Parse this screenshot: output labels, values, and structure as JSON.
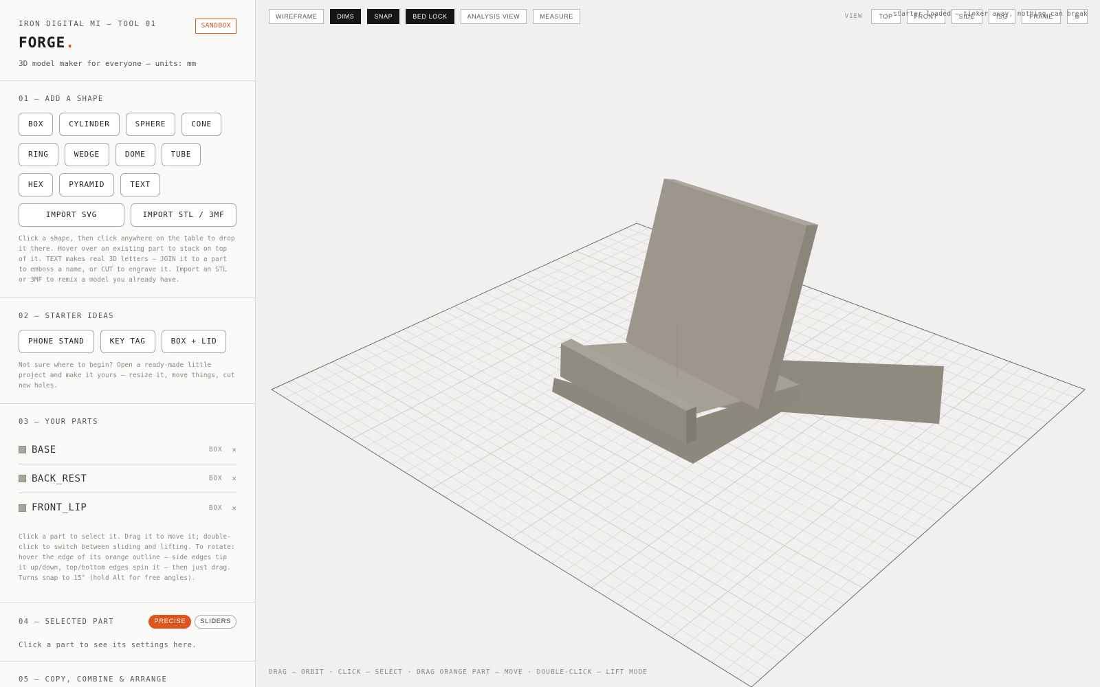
{
  "header": {
    "brand_line": "IRON DIGITAL MI — TOOL 01",
    "badge": "SANDBOX",
    "title": "FORGE",
    "title_dot": ".",
    "tagline": "3D model maker for everyone — units: mm"
  },
  "add_shape": {
    "title": "01 — ADD A SHAPE",
    "shapes": [
      "BOX",
      "CYLINDER",
      "SPHERE",
      "CONE",
      "RING",
      "WEDGE",
      "DOME",
      "TUBE",
      "HEX",
      "PYRAMID",
      "TEXT"
    ],
    "import_svg": "IMPORT SVG",
    "import_stl": "IMPORT STL / 3MF",
    "help": "Click a shape, then click anywhere on the table to drop it there. Hover over an existing part to stack on top of it. TEXT makes real 3D letters — JOIN it to a part to emboss a name, or CUT to engrave it. Import an STL or 3MF to remix a model you already have."
  },
  "starter": {
    "title": "02 — STARTER IDEAS",
    "ideas": [
      "PHONE STAND",
      "KEY TAG",
      "BOX + LID"
    ],
    "help": "Not sure where to begin? Open a ready-made little project and make it yours — resize it, move things, cut new holes."
  },
  "parts": {
    "title": "03 — YOUR PARTS",
    "items": [
      {
        "name": "BASE",
        "kind": "BOX",
        "remove": "×"
      },
      {
        "name": "BACK_REST",
        "kind": "BOX",
        "remove": "×"
      },
      {
        "name": "FRONT_LIP",
        "kind": "BOX",
        "remove": "×"
      }
    ],
    "help": "Click a part to select it. Drag it to move it; double-click to switch between sliding and lifting. To rotate: hover the edge of its orange outline — side edges tip it up/down, top/bottom edges spin it — then just drag. Turns snap to 15° (hold Alt for free angles)."
  },
  "selected": {
    "title": "04 — SELECTED PART",
    "mode_precise": "PRECISE",
    "mode_sliders": "SLIDERS",
    "empty": "Click a part to see its settings here."
  },
  "arrange": {
    "title": "05 — COPY, COMBINE & ARRANGE"
  },
  "toolbar": {
    "items": [
      {
        "label": "WIREFRAME",
        "on": false
      },
      {
        "label": "DIMS",
        "on": true
      },
      {
        "label": "SNAP",
        "on": true
      },
      {
        "label": "BED LOCK",
        "on": true
      },
      {
        "label": "ANALYSIS VIEW",
        "on": false
      },
      {
        "label": "MEASURE",
        "on": false
      }
    ]
  },
  "view": {
    "label": "VIEW",
    "buttons": [
      "TOP",
      "FRONT",
      "SIDE",
      "ISO",
      "FRAME",
      "⊕"
    ]
  },
  "status": "starter loaded — tinker away, nothing can break",
  "hint": "DRAG — ORBIT · CLICK — SELECT · DRAG ORANGE PART — MOVE · DOUBLE-CLICK — LIFT MODE",
  "colors": {
    "accent": "#e0531c",
    "part_top": "#aaa59d",
    "part_side": "#8c887e",
    "part_front": "#9d978d"
  }
}
